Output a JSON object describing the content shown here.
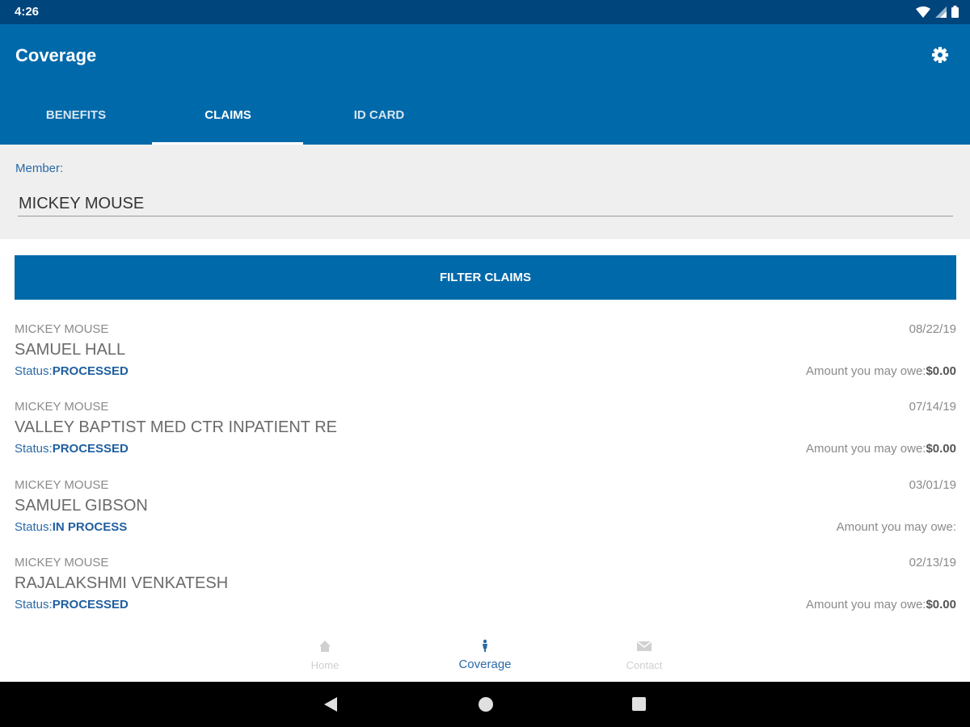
{
  "status_bar": {
    "time": "4:26"
  },
  "app_bar": {
    "title": "Coverage"
  },
  "tabs": [
    {
      "label": "BENEFITS",
      "active": false
    },
    {
      "label": "CLAIMS",
      "active": true
    },
    {
      "label": "ID CARD",
      "active": false
    }
  ],
  "member": {
    "label": "Member:",
    "value": "MICKEY MOUSE"
  },
  "filter": {
    "label": "FILTER CLAIMS"
  },
  "claims": [
    {
      "member": "MICKEY MOUSE",
      "date": "08/22/19",
      "provider": "SAMUEL HALL",
      "status_label": "Status:",
      "status": "PROCESSED",
      "amount_label": "Amount you may owe:",
      "amount": "$0.00"
    },
    {
      "member": "MICKEY MOUSE",
      "date": "07/14/19",
      "provider": "VALLEY BAPTIST MED CTR INPATIENT RE",
      "status_label": "Status:",
      "status": "PROCESSED",
      "amount_label": "Amount you may owe:",
      "amount": "$0.00"
    },
    {
      "member": "MICKEY MOUSE",
      "date": "03/01/19",
      "provider": "SAMUEL GIBSON",
      "status_label": "Status:",
      "status": "IN PROCESS",
      "amount_label": "Amount you may owe:",
      "amount": ""
    },
    {
      "member": "MICKEY MOUSE",
      "date": "02/13/19",
      "provider": "RAJALAKSHMI VENKATESH",
      "status_label": "Status:",
      "status": "PROCESSED",
      "amount_label": "Amount you may owe:",
      "amount": "$0.00"
    }
  ],
  "bottom_nav": [
    {
      "label": "Home",
      "icon": "home-icon",
      "active": false
    },
    {
      "label": "Coverage",
      "icon": "coverage-icon",
      "active": true
    },
    {
      "label": "Contact",
      "icon": "mail-icon",
      "active": false
    }
  ],
  "colors": {
    "primary": "#0069aa",
    "status_bar": "#00457c",
    "panel": "#efefef",
    "accent_text": "#2a6aa6"
  }
}
